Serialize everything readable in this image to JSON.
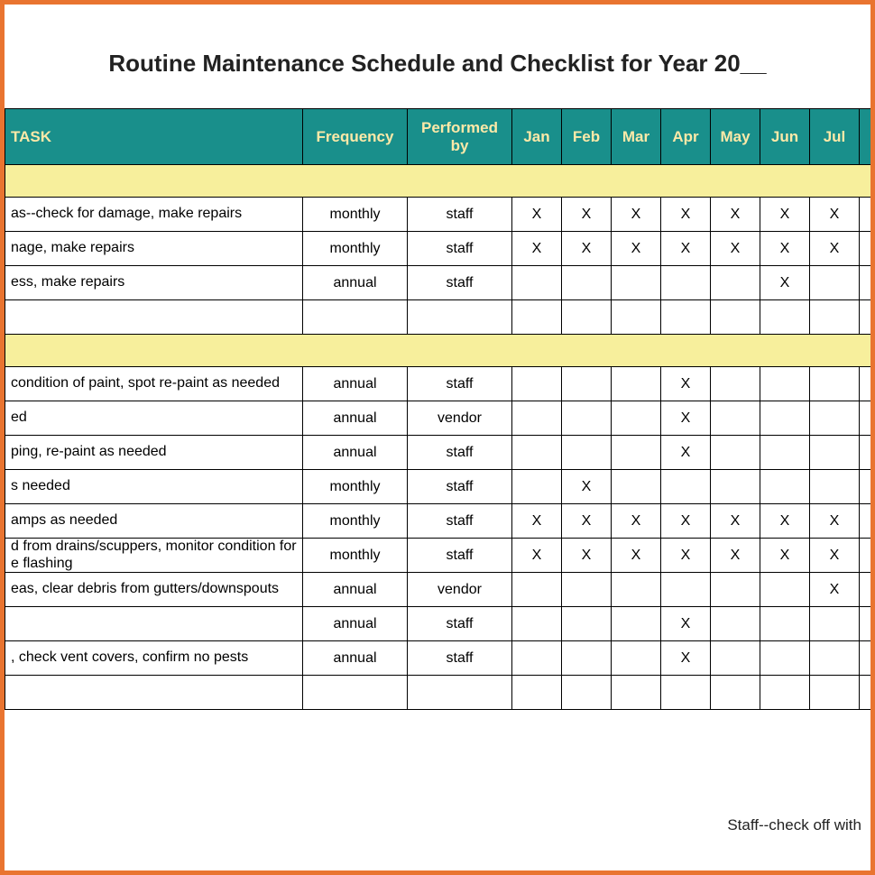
{
  "title": "Routine Maintenance Schedule and Checklist for Year 20__",
  "headers": {
    "task": "TASK",
    "frequency": "Frequency",
    "performed_by": "Performed by",
    "months": [
      "Jan",
      "Feb",
      "Mar",
      "Apr",
      "May",
      "Jun",
      "Jul"
    ]
  },
  "mark": "X",
  "rows": [
    {
      "type": "section"
    },
    {
      "type": "data",
      "task": "as--check for damage, make repairs",
      "frequency": "monthly",
      "performed_by": "staff",
      "months": [
        true,
        true,
        true,
        true,
        true,
        true,
        true
      ]
    },
    {
      "type": "data",
      "task": "nage, make repairs",
      "frequency": "monthly",
      "performed_by": "staff",
      "months": [
        true,
        true,
        true,
        true,
        true,
        true,
        true
      ]
    },
    {
      "type": "data",
      "task": "ess, make repairs",
      "frequency": "annual",
      "performed_by": "staff",
      "months": [
        false,
        false,
        false,
        false,
        false,
        true,
        false
      ]
    },
    {
      "type": "data",
      "task": "",
      "frequency": "",
      "performed_by": "",
      "months": [
        false,
        false,
        false,
        false,
        false,
        false,
        false
      ]
    },
    {
      "type": "section"
    },
    {
      "type": "data",
      "task": "condition of paint, spot re-paint as needed",
      "frequency": "annual",
      "performed_by": "staff",
      "months": [
        false,
        false,
        false,
        true,
        false,
        false,
        false
      ]
    },
    {
      "type": "data",
      "task": "ed",
      "frequency": "annual",
      "performed_by": "vendor",
      "months": [
        false,
        false,
        false,
        true,
        false,
        false,
        false
      ]
    },
    {
      "type": "data",
      "task": "ping, re-paint as needed",
      "frequency": "annual",
      "performed_by": "staff",
      "months": [
        false,
        false,
        false,
        true,
        false,
        false,
        false
      ]
    },
    {
      "type": "data",
      "task": "s needed",
      "frequency": "monthly",
      "performed_by": "staff",
      "months": [
        false,
        true,
        false,
        false,
        false,
        false,
        false
      ]
    },
    {
      "type": "data",
      "task": "amps as needed",
      "frequency": "monthly",
      "performed_by": "staff",
      "months": [
        true,
        true,
        true,
        true,
        true,
        true,
        true
      ]
    },
    {
      "type": "data",
      "multi": true,
      "task": "d from drains/scuppers, monitor condition for e flashing",
      "frequency": "monthly",
      "performed_by": "staff",
      "months": [
        true,
        true,
        true,
        true,
        true,
        true,
        true
      ]
    },
    {
      "type": "data",
      "task": "eas, clear debris from gutters/downspouts",
      "frequency": "annual",
      "performed_by": "vendor",
      "months": [
        false,
        false,
        false,
        false,
        false,
        false,
        true
      ]
    },
    {
      "type": "data",
      "task": "",
      "frequency": "annual",
      "performed_by": "staff",
      "months": [
        false,
        false,
        false,
        true,
        false,
        false,
        false
      ]
    },
    {
      "type": "data",
      "task": ", check vent covers, confirm no pests",
      "frequency": "annual",
      "performed_by": "staff",
      "months": [
        false,
        false,
        false,
        true,
        false,
        false,
        false
      ]
    },
    {
      "type": "data",
      "task": "",
      "frequency": "",
      "performed_by": "",
      "months": [
        false,
        false,
        false,
        false,
        false,
        false,
        false
      ]
    }
  ],
  "footer_note": "Staff--check off with"
}
